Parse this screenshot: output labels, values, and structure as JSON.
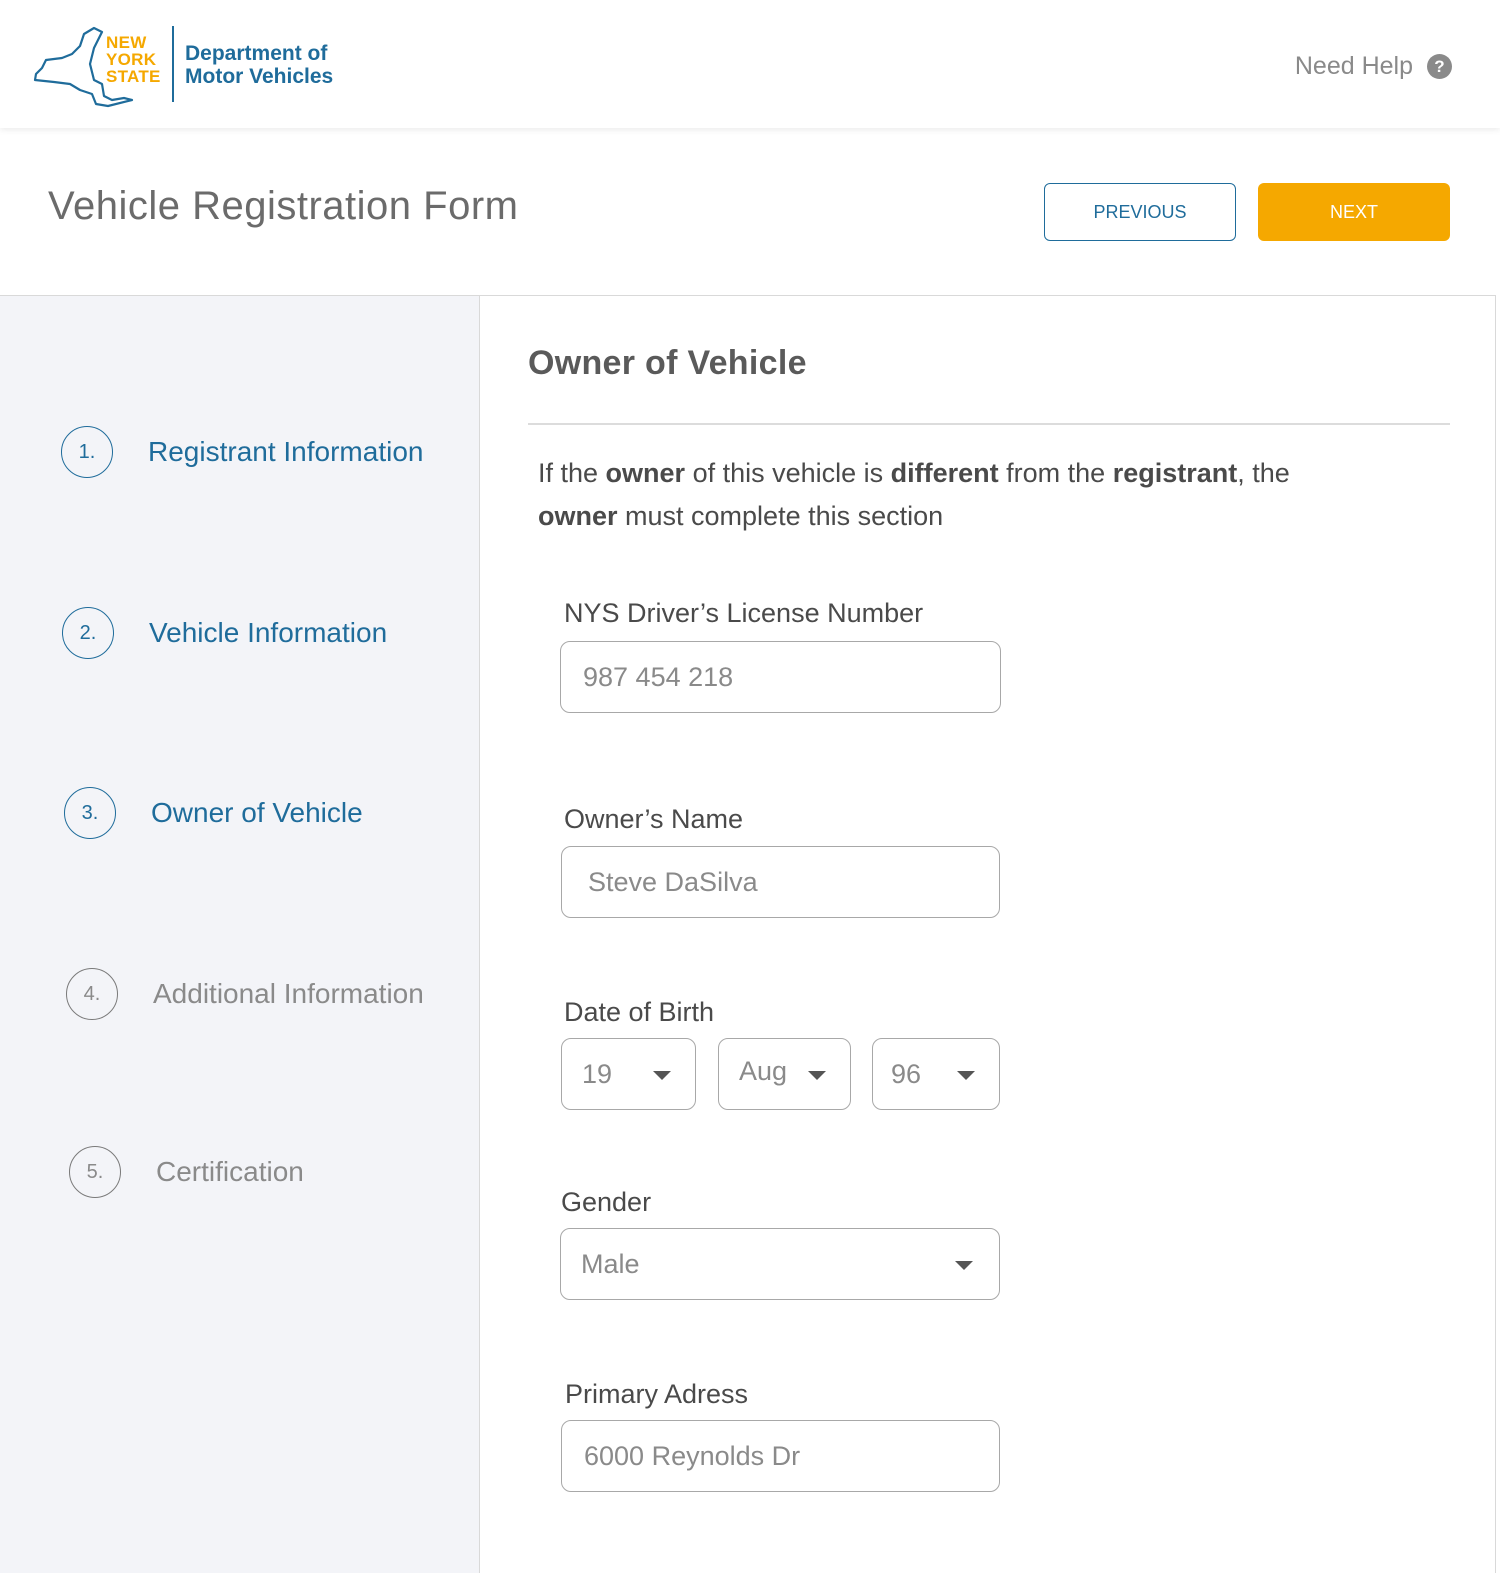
{
  "header": {
    "logo_state": [
      "NEW",
      "YORK",
      "STATE"
    ],
    "logo_dept": [
      "Department of",
      "Motor Vehicles"
    ],
    "help_label": "Need Help",
    "help_icon": "?"
  },
  "page": {
    "title": "Vehicle Registration Form",
    "previous_label": "PREVIOUS",
    "next_label": "NEXT"
  },
  "steps": [
    {
      "number": "1.",
      "label": "Registrant Information",
      "state": "complete"
    },
    {
      "number": "2.",
      "label": "Vehicle Information",
      "state": "complete"
    },
    {
      "number": "3.",
      "label": "Owner of Vehicle",
      "state": "current"
    },
    {
      "number": "4.",
      "label": "Additional Information",
      "state": "upcoming"
    },
    {
      "number": "5.",
      "label": "Certification",
      "state": "upcoming"
    }
  ],
  "form": {
    "section_title": "Owner of Vehicle",
    "intro": {
      "p1": "If the ",
      "b1": "owner",
      "p2": " of this vehicle is ",
      "b2": "different",
      "p3": " from the ",
      "b3": "registrant",
      "p4": ", the ",
      "b4": "owner",
      "p5": " must complete this section"
    },
    "license": {
      "label": "NYS Driver’s License Number",
      "value": "987 454 218"
    },
    "owner_name": {
      "label": "Owner’s Name",
      "value": "Steve DaSilva"
    },
    "dob": {
      "label": "Date of Birth",
      "day": "19",
      "month": "Aug",
      "year": "96"
    },
    "gender": {
      "label": "Gender",
      "value": "Male"
    },
    "address": {
      "label": "Primary Adress",
      "value": "6000 Reynolds Dr"
    }
  },
  "colors": {
    "brand_blue": "#1f6c9b",
    "accent_orange": "#f5a800",
    "sidebar_bg": "#f3f4f8"
  }
}
